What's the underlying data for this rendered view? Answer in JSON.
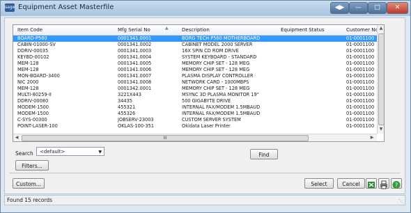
{
  "window": {
    "title": "Equipment Asset Masterfile",
    "app_icon_text": "sage"
  },
  "grid": {
    "columns": [
      "Item Code",
      "Mfg Serial No",
      "Description",
      "Equipment Status",
      "Customer No"
    ],
    "rows": [
      [
        "BOARD-P560",
        "0001341.0001",
        "BORG TECH P560 MOTHERBOARD",
        "",
        "01-0001100"
      ],
      [
        "CABIN-01000-SV",
        "0001341.0002",
        "CABINET MODEL 2000 SERVER",
        "",
        "01-0001100"
      ],
      [
        "DDRIV-00035",
        "0001341.0003",
        "16X SPIN CD ROM DRIVE",
        "",
        "01-0001100"
      ],
      [
        "KEYBD-00102",
        "0001341.0004",
        "SYSTEM KEYBOARD - STANDARD",
        "",
        "01-0001100"
      ],
      [
        "MEM-128",
        "0001341.0005",
        "MEMORY CHIP SET - 128 MEG",
        "",
        "01-0001100"
      ],
      [
        "MEM-128",
        "0001341.0006",
        "MEMORY CHIP SET - 128 MEG",
        "",
        "01-0001100"
      ],
      [
        "MON-BOARD-3400",
        "0001341.0007",
        "PLASMA DISPLAY CONTROLLER",
        "",
        "01-0001100"
      ],
      [
        "NIC 2000",
        "0001341.0008",
        "NETWORK CARD - 1000MBPS",
        "",
        "01-0001100"
      ],
      [
        "MEM-128",
        "0001342.0001",
        "MEMORY CHIP SET - 128 MEG",
        "",
        "01-0001100"
      ],
      [
        "MULTI-80259-II",
        "3221X443",
        "MSYNC 3D PLASMA MONITOR 19\"",
        "",
        "01-0001100"
      ],
      [
        "DDRIV-00080",
        "34435",
        "500 GIGABYTE DRIVE",
        "",
        "01-0001100"
      ],
      [
        "MODEM-1500",
        "455321",
        "INTERNAL FAX/MODEM 1.5MBAUD",
        "",
        "01-0001100"
      ],
      [
        "MODEM-1500",
        "455326",
        "INTERNAL FAX/MODEM 1.5MBAUD",
        "",
        "01-0001100"
      ],
      [
        "C-SYS-00300",
        "JOBSERV-23003",
        "CUSTOM SERVER SYSTEM",
        "",
        "01-0001100"
      ],
      [
        "POINT-LASER-100",
        "OKLAS-100-351",
        "Okidata Laser Printer",
        "",
        "01-0001100"
      ]
    ],
    "selected_row": 0
  },
  "search": {
    "label": "Search",
    "selected_value": "<default>"
  },
  "buttons": {
    "filters": "Filters...",
    "find": "Find",
    "custom": "Custom...",
    "select": "Select",
    "cancel": "Cancel"
  },
  "status": {
    "text": "Found 15 records"
  },
  "icons": {
    "export": "excel-export-icon",
    "print": "printer-icon",
    "help": "help-icon"
  }
}
